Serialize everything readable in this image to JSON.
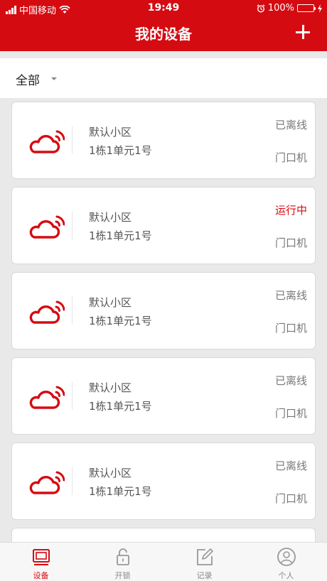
{
  "status_bar": {
    "carrier": "中国移动",
    "time": "19:49",
    "battery": "100%"
  },
  "header": {
    "title": "我的设备",
    "add_icon": "plus-icon"
  },
  "filter": {
    "selected": "全部",
    "icon": "caret-down-icon"
  },
  "devices": [
    {
      "name": "默认小区",
      "address": "1栋1单元1号",
      "status": "已离线",
      "type": "门口机"
    },
    {
      "name": "默认小区",
      "address": "1栋1单元1号",
      "status": "运行中",
      "type": "门口机"
    },
    {
      "name": "默认小区",
      "address": "1栋1单元1号",
      "status": "已离线",
      "type": "门口机"
    },
    {
      "name": "默认小区",
      "address": "1栋1单元1号",
      "status": "已离线",
      "type": "门口机"
    },
    {
      "name": "默认小区",
      "address": "1栋1单元1号",
      "status": "已离线",
      "type": "门口机"
    }
  ],
  "tabs": [
    {
      "label": "设备",
      "icon": "device-icon",
      "active": true
    },
    {
      "label": "开锁",
      "icon": "lock-icon",
      "active": false
    },
    {
      "label": "记录",
      "icon": "edit-icon",
      "active": false
    },
    {
      "label": "个人",
      "icon": "user-icon",
      "active": false
    }
  ],
  "colors": {
    "brand": "#d50b12",
    "battery": "#3fd34a"
  }
}
